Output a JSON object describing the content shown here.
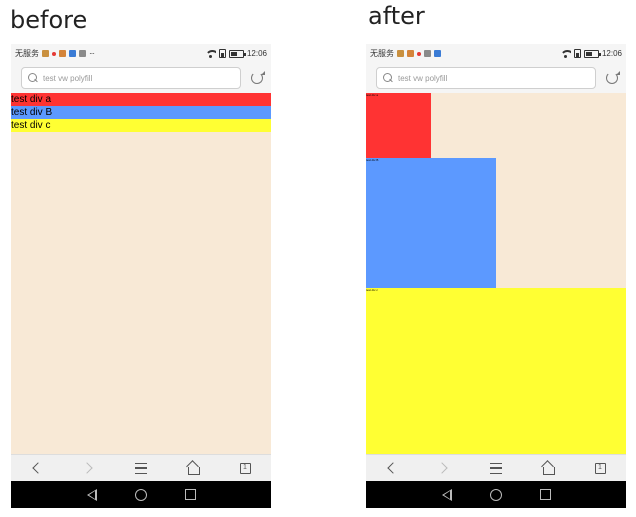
{
  "labels": {
    "before": "before",
    "after": "after"
  },
  "status_bar": {
    "carrier": "无服务",
    "time": "12:06",
    "more": "···"
  },
  "search": {
    "placeholder": "test vw polyfill"
  },
  "test_divs": {
    "a": "test div a",
    "b": "test div B",
    "c": "test div c"
  },
  "nav": {
    "tabs_count": "1"
  },
  "colors": {
    "page_background": "#f8e9d6",
    "div_a": "#ff3333",
    "div_b": "#5c99ff",
    "div_c": "#ffff33"
  }
}
